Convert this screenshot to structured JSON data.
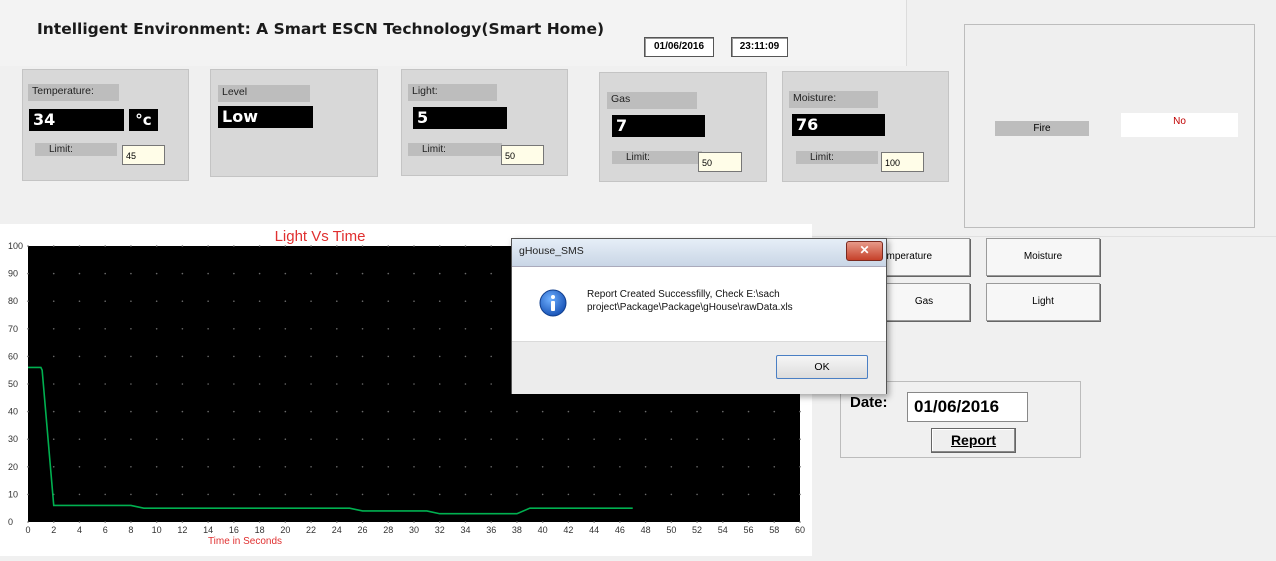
{
  "header": {
    "title": "Intelligent Environment: A Smart ESCN Technology(Smart Home)",
    "date": "01/06/2016",
    "time": "23:11:09"
  },
  "sensors": {
    "temperature": {
      "label": "Temperature:",
      "value": "34",
      "unit": "°c",
      "limit_label": "Limit:",
      "limit_value": "45"
    },
    "level": {
      "label": "Level",
      "value": "Low"
    },
    "light": {
      "label": "Light:",
      "value": "5",
      "limit_label": "Limit:",
      "limit_value": "50"
    },
    "gas": {
      "label": "Gas",
      "value": "7",
      "limit_label": "Limit:",
      "limit_value": "50"
    },
    "moisture": {
      "label": "Moisture:",
      "value": "76",
      "limit_label": "Limit:",
      "limit_value": "100"
    }
  },
  "fire": {
    "label": "Fire",
    "value": "No"
  },
  "graph_buttons": {
    "temperature": "Temperature",
    "moisture": "Moisture",
    "gas": "Gas",
    "light": "Light"
  },
  "report": {
    "date_label": "Date:",
    "date_value": "01/06/2016",
    "button_label": "Report"
  },
  "dialog": {
    "title": "gHouse_SMS",
    "close_glyph": "✕",
    "message": "Report Created Successfilly, Check E:\\sach project\\Package\\Package\\gHouse\\rawData.xls",
    "ok_label": "OK",
    "icon": "info-icon"
  },
  "colors": {
    "chart_bg": "#000000",
    "line": "#00b050",
    "chart_title": "#e03030",
    "fire_no": "#c00000"
  },
  "chart_data": {
    "type": "line",
    "title": "Light Vs Time",
    "xlabel": "Time in Seconds",
    "ylabel": "",
    "xlim": [
      0,
      60
    ],
    "ylim": [
      0,
      100
    ],
    "x_ticks": [
      0,
      2,
      4,
      6,
      8,
      10,
      12,
      14,
      16,
      18,
      20,
      22,
      24,
      26,
      28,
      30,
      32,
      34,
      36,
      38,
      40,
      42,
      44,
      46,
      48,
      50,
      52,
      54,
      56,
      58,
      60
    ],
    "y_ticks": [
      0,
      10,
      20,
      30,
      40,
      50,
      60,
      70,
      80,
      90,
      100
    ],
    "grid": "dotted",
    "series": [
      {
        "color": "#00b050",
        "x": [
          0,
          1,
          1.1,
          2,
          8,
          9,
          25,
          26,
          31,
          32,
          38,
          39,
          47
        ],
        "y": [
          56,
          56,
          55,
          6,
          6,
          5,
          5,
          4,
          4,
          3,
          3,
          5,
          5
        ]
      }
    ]
  }
}
